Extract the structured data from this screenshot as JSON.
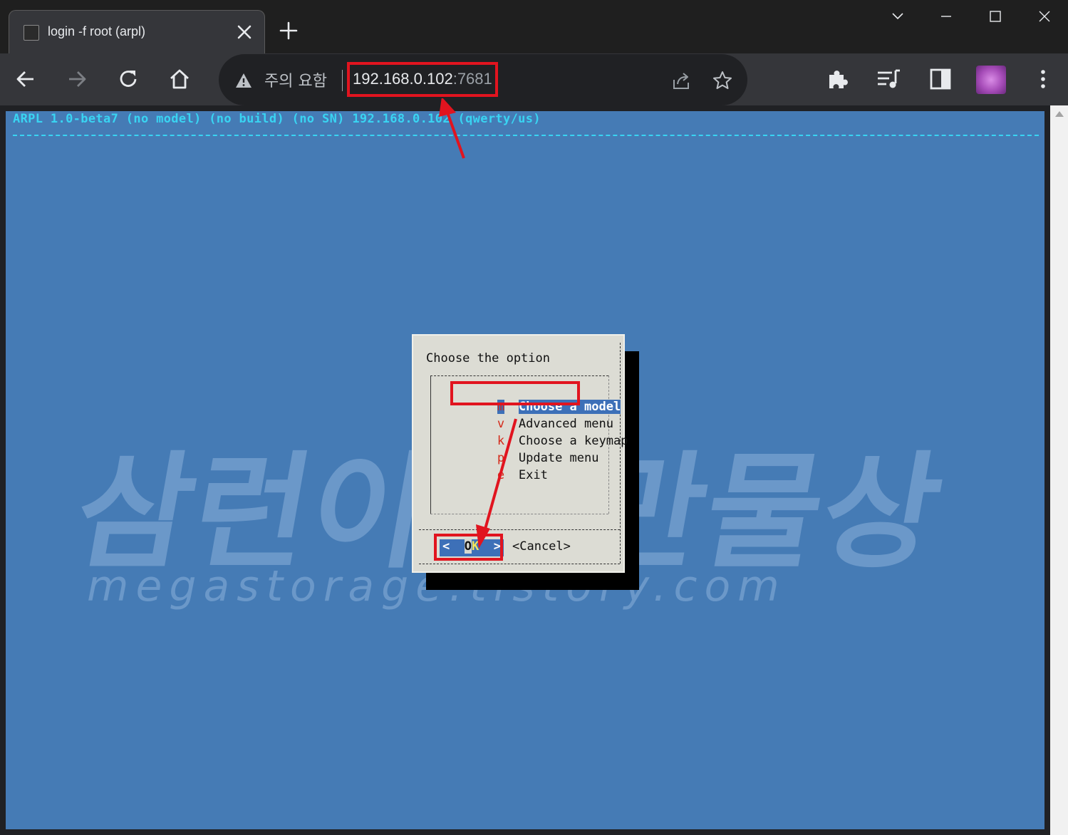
{
  "browser": {
    "tab": {
      "title": "login -f root (arpl)"
    },
    "new_tab_symbol": "+",
    "omnibox": {
      "security_warning": "주의 요함",
      "url_host": "192.168.0.102",
      "url_port": ":7681"
    }
  },
  "terminal": {
    "banner": "ARPL 1.0-beta7 (no model) (no build) (no SN) 192.168.0.102 (qwerty/us)",
    "dialog": {
      "prompt": "Choose the option",
      "menu": [
        {
          "key": "m",
          "label": "Choose a model",
          "selected": true
        },
        {
          "key": "v",
          "label": "Advanced menu",
          "selected": false
        },
        {
          "key": "k",
          "label": "Choose a keymap",
          "selected": false
        },
        {
          "key": "p",
          "label": "Update menu",
          "selected": false
        },
        {
          "key": "e",
          "label": "Exit",
          "selected": false
        }
      ],
      "ok": {
        "left": "<",
        "o": "O",
        "k": "K",
        "right": ">"
      },
      "cancel_label": "<Cancel>"
    }
  },
  "watermark": {
    "main": "삼런이의 만물상",
    "sub": "megastorage.tistory.com"
  },
  "colors": {
    "terminal_bg": "#457bb5",
    "banner": "#39d4f2",
    "highlight_box": "#e1141f",
    "dialog_bg": "#dcdcd4"
  },
  "icons": {
    "back": "arrow-left-icon",
    "forward": "arrow-right-icon",
    "reload": "reload-icon",
    "home": "home-icon",
    "warning": "warning-triangle-icon",
    "share": "share-icon",
    "bookmark": "star-icon",
    "extensions": "puzzle-icon",
    "media": "media-queue-icon",
    "side_panel": "side-panel-icon",
    "menu": "kebab-menu-icon"
  }
}
